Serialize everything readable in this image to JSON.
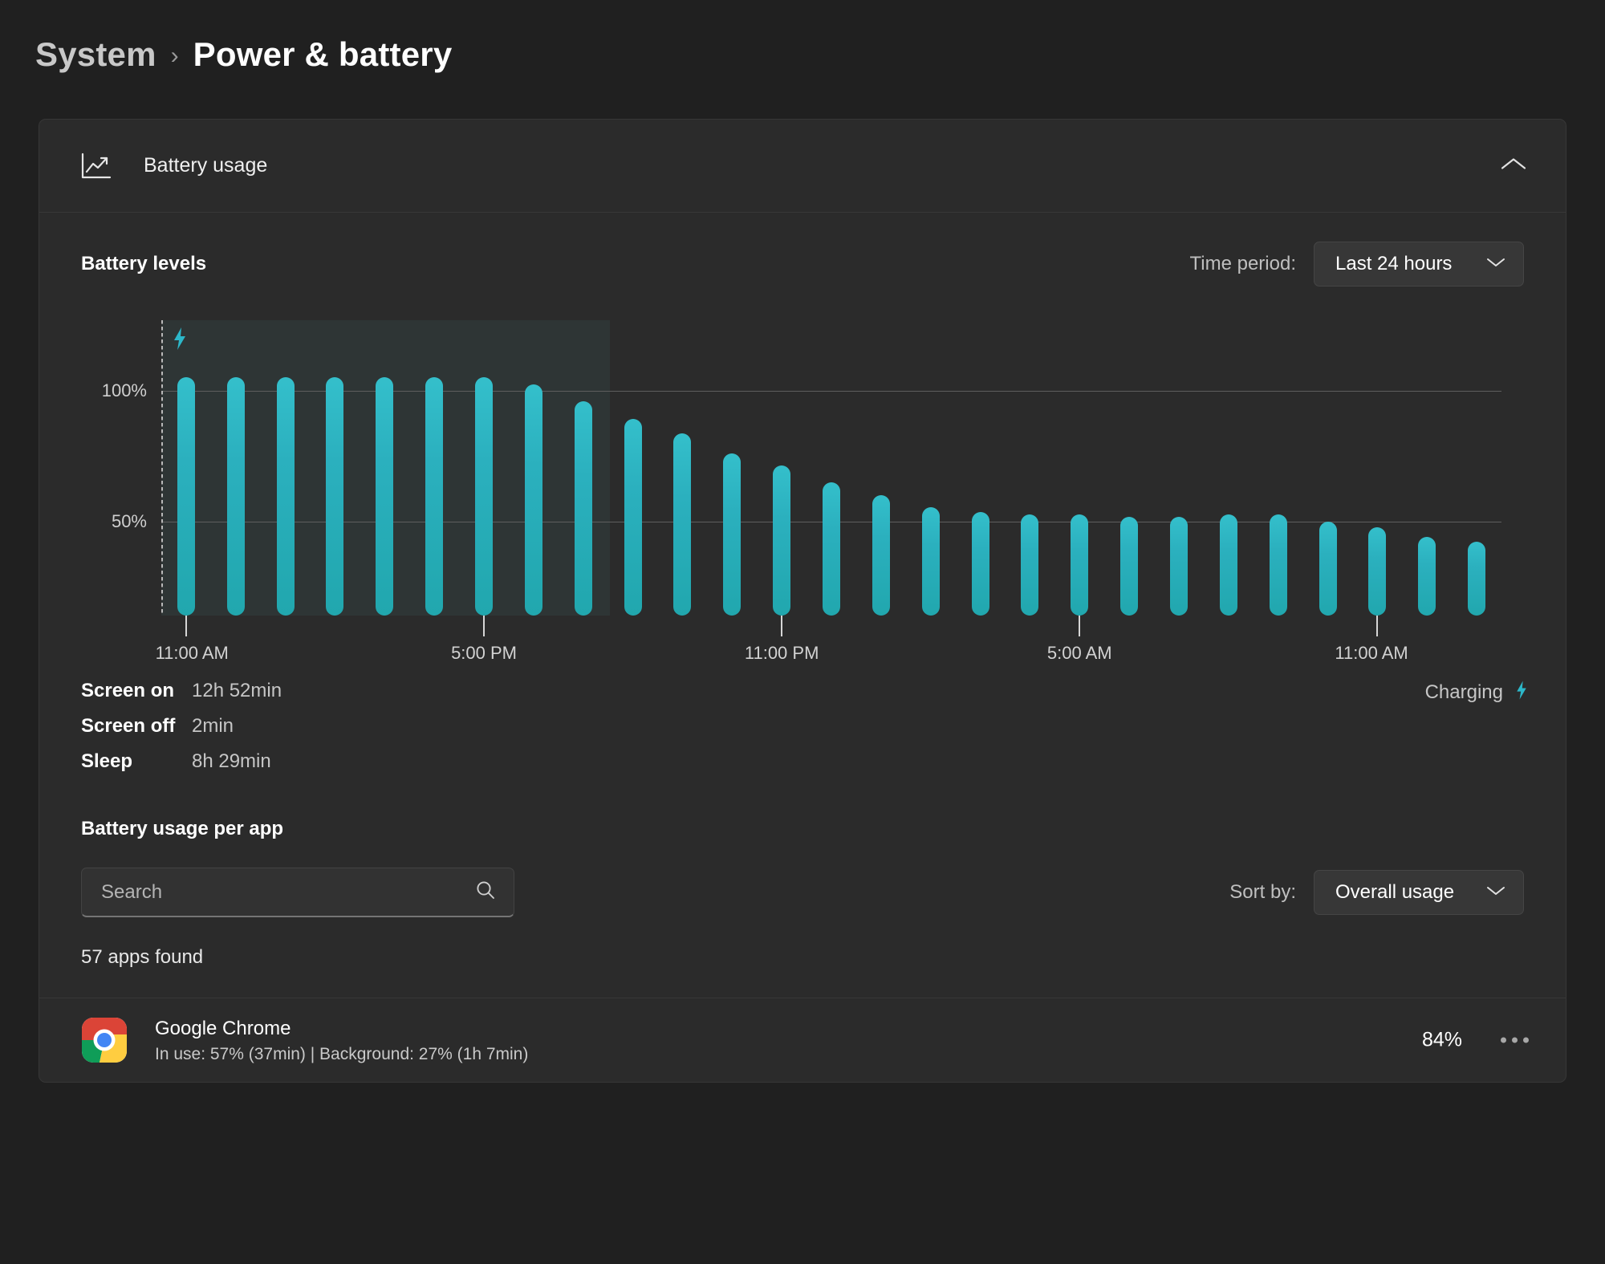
{
  "breadcrumb": {
    "root": "System",
    "separator": "›",
    "current": "Power & battery"
  },
  "card": {
    "header_title": "Battery usage",
    "header_icon": "line-chart-icon",
    "collapse_icon": "chevron-up-icon"
  },
  "battery_levels": {
    "title": "Battery levels",
    "time_period_label": "Time period:",
    "time_period_value": "Last 24 hours",
    "time_period_icon": "chevron-down-icon",
    "charging_marker_icon": "lightning-bolt-icon"
  },
  "stats": {
    "rows": [
      {
        "key": "Screen on",
        "value": "12h 52min"
      },
      {
        "key": "Screen off",
        "value": "2min"
      },
      {
        "key": "Sleep",
        "value": "8h 29min"
      }
    ],
    "status_text": "Charging",
    "status_icon": "lightning-bolt-icon",
    "status_color": "#29b6c6"
  },
  "per_app": {
    "title": "Battery usage per app",
    "search_placeholder": "Search",
    "search_value": "",
    "search_icon": "search-icon",
    "sort_label": "Sort by:",
    "sort_value": "Overall usage",
    "sort_icon": "chevron-down-icon",
    "apps_found": "57 apps found",
    "rows": [
      {
        "name": "Google Chrome",
        "icon": "google-chrome-icon",
        "detail": "In use: 57% (37min) | Background: 27% (1h 7min)",
        "percent": "84%",
        "menu_icon": "more-options-icon"
      }
    ]
  },
  "chart_data": {
    "type": "bar",
    "title": "Battery levels",
    "xlabel": "",
    "ylabel": "",
    "ylim": [
      0,
      120
    ],
    "yticks": [
      50,
      100
    ],
    "ytick_labels": [
      "50%",
      "100%"
    ],
    "grid": true,
    "legend": null,
    "xtick_labels": [
      "11:00 AM",
      "5:00 PM",
      "11:00 PM",
      "5:00 AM",
      "11:00 AM"
    ],
    "xtick_indices": [
      0,
      6,
      12,
      18,
      24
    ],
    "categories": [
      "11:00 AM",
      "12:00 PM",
      "1:00 PM",
      "2:00 PM",
      "3:00 PM",
      "4:00 PM",
      "5:00 PM",
      "6:00 PM",
      "7:00 PM",
      "8:00 PM",
      "9:00 PM",
      "10:00 PM",
      "11:00 PM",
      "12:00 AM",
      "1:00 AM",
      "2:00 AM",
      "3:00 AM",
      "4:00 AM",
      "5:00 AM",
      "6:00 AM",
      "7:00 AM",
      "8:00 AM",
      "9:00 AM",
      "10:00 AM",
      "11:00 AM",
      "12:00 PM",
      "1:00 PM"
    ],
    "values": [
      97,
      97,
      97,
      97,
      97,
      97,
      97,
      94,
      87,
      80,
      74,
      66,
      61,
      54,
      49,
      44,
      42,
      41,
      41,
      40,
      40,
      41,
      41,
      38,
      36,
      32,
      30
    ],
    "annotations": [
      {
        "type": "charging_region",
        "from_index": 0,
        "to_index": 8,
        "label": "charging",
        "icon": "lightning-bolt-icon"
      }
    ],
    "bar_color_top": "#34bfcb",
    "bar_color_bottom": "#21a7ae"
  }
}
